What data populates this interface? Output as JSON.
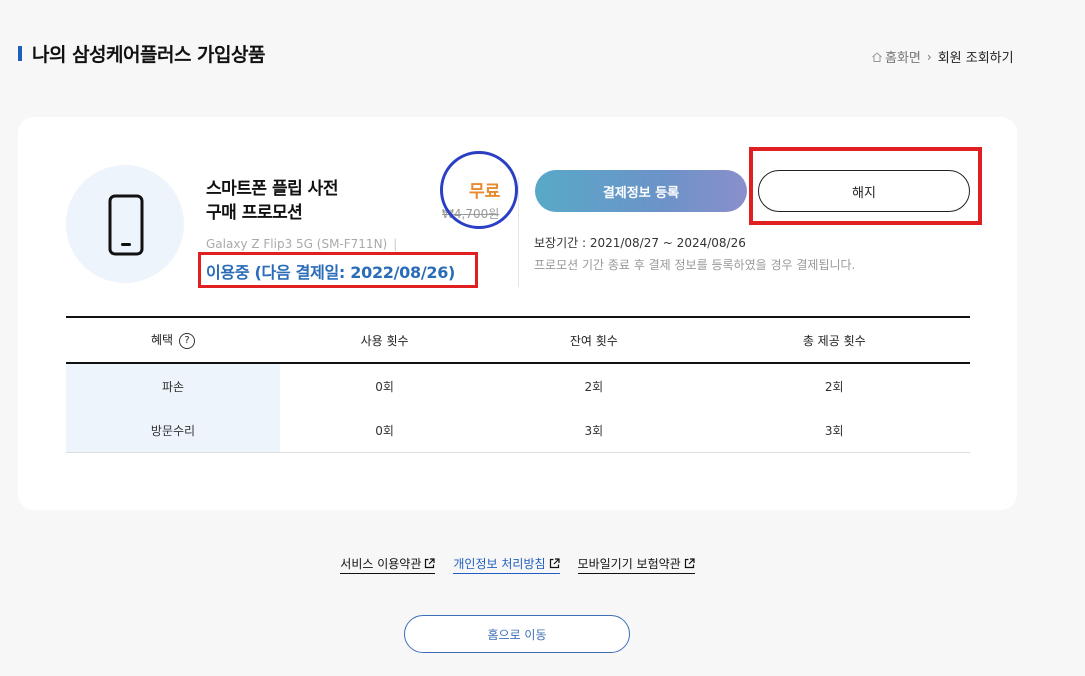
{
  "header": {
    "title": "나의 삼성케어플러스 가입상품",
    "breadcrumb": {
      "home": "홈화면",
      "current": "회원 조회하기"
    }
  },
  "product": {
    "icon": "smartphone-icon",
    "name_line1": "스마트폰 플립 사전",
    "name_line2": "구매 프로모션",
    "model": "Galaxy Z Flip3 5G (SM-F711N)",
    "status": "이용중 (다음 결제일: 2022/08/26)",
    "price_label": "무료",
    "original_price": "₩4,700원"
  },
  "actions": {
    "pay_label": "결제정보 등록",
    "cancel_label": "해지"
  },
  "warranty": {
    "period": "보장기간 : 2021/08/27 ~ 2024/08/26",
    "note": "프로모션 기간 종료 후 결제 정보를 등록하였을 경우 결제됩니다."
  },
  "benefits": {
    "columns": [
      "혜택",
      "사용 횟수",
      "잔여 횟수",
      "총 제공 횟수"
    ],
    "help_glyph": "?",
    "rows": [
      {
        "name": "파손",
        "used": "0회",
        "remaining": "2회",
        "total": "2회"
      },
      {
        "name": "방문수리",
        "used": "0회",
        "remaining": "3회",
        "total": "3회"
      }
    ]
  },
  "footer": {
    "links": [
      "서비스 이용약관",
      "개인정보 처리방침",
      "모바일기기 보험약관"
    ],
    "home_button": "홈으로 이동"
  },
  "colors": {
    "accent_blue": "#1f5ebf",
    "status_blue": "#2b6cb8",
    "free_orange": "#e98a2e",
    "annotation_red": "#e02020",
    "annotation_blue": "#2a3fc4"
  }
}
